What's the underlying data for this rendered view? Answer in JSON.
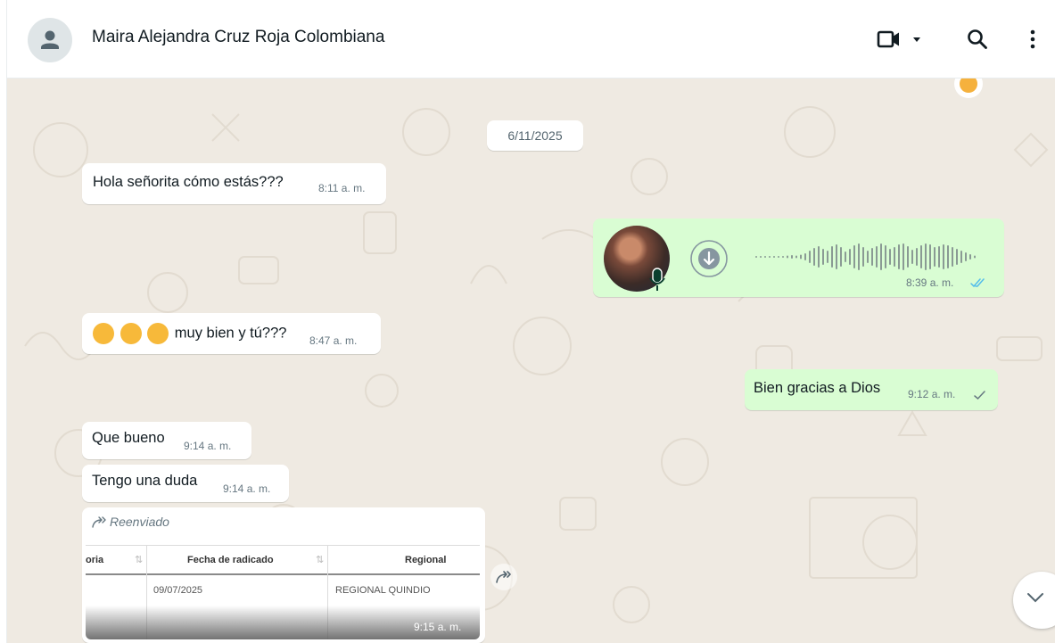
{
  "header": {
    "contact_name": "Maira Alejandra Cruz Roja Colombiana",
    "icons": {
      "avatar": "person-icon",
      "video": "video-call-icon",
      "search": "search-icon",
      "menu": "more-vertical-icon"
    }
  },
  "chat": {
    "date_chip": "6/11/2025",
    "messages": [
      {
        "dir": "in",
        "text": "Hola señorita cómo estás???",
        "time": "8:11 a. m."
      },
      {
        "dir": "out",
        "type": "voice",
        "time": "8:39 a. m.",
        "status": "read"
      },
      {
        "dir": "in",
        "text": "muy bien y tú???",
        "time": "8:47 a. m.",
        "emojis": [
          "face-with-hand-over-mouth",
          "face-with-hand-over-mouth",
          "face-blowing-kiss"
        ]
      },
      {
        "dir": "out",
        "text": "Bien gracias a Dios",
        "time": "9:12 a. m.",
        "status": "sent"
      },
      {
        "dir": "in",
        "text": "Que bueno",
        "time": "9:14 a. m."
      },
      {
        "dir": "in",
        "text": "Tengo una duda",
        "time": "9:14 a. m."
      },
      {
        "dir": "in",
        "type": "forwarded-image",
        "forward_label": "Reenviado",
        "time": "9:15 a. m.",
        "table": {
          "headers": [
            "oria",
            "Fecha de radicado",
            "Regional"
          ],
          "row": [
            "",
            "09/07/2025",
            "REGIONAL QUINDIO"
          ]
        }
      }
    ]
  },
  "colors": {
    "incoming": "#ffffff",
    "outgoing": "#d9fdd3",
    "wallpaper": "#efeae2",
    "read_tick": "#53bdeb",
    "meta": "#667781"
  }
}
